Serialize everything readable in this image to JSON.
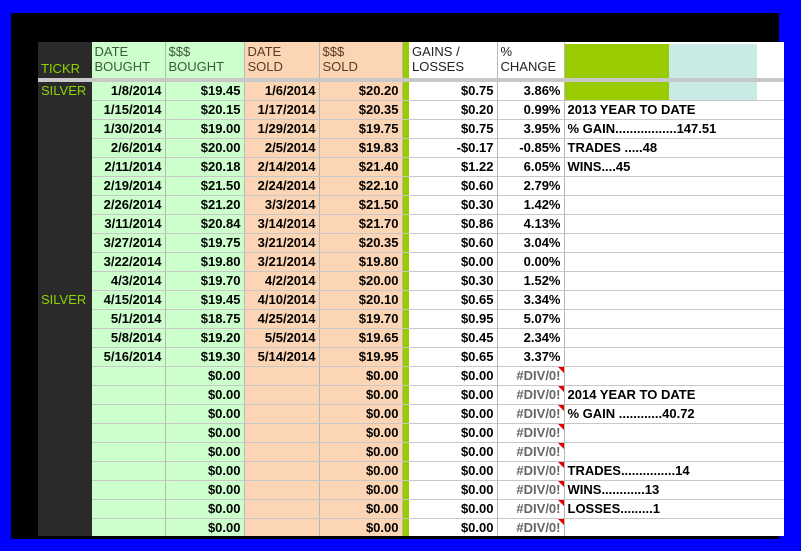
{
  "headers": {
    "tickr": "TICKR",
    "date_bought": [
      "DATE",
      "BOUGHT"
    ],
    "price_bought": [
      "$$$",
      "BOUGHT"
    ],
    "date_sold": [
      "DATE",
      "SOLD"
    ],
    "price_sold": [
      "$$$",
      "SOLD"
    ],
    "gains": [
      "GAINS /",
      "LOSSES"
    ],
    "pct_change": [
      "%",
      "CHANGE"
    ]
  },
  "rows": [
    {
      "tickr": "SILVER",
      "date_bought": "1/8/2014",
      "bought": "$19.45",
      "date_sold": "1/6/2014",
      "sold": "$20.20",
      "gain": "$0.75",
      "pct": "3.86%",
      "note": ""
    },
    {
      "tickr": "",
      "date_bought": "1/15/2014",
      "bought": "$20.15",
      "date_sold": "1/17/2014",
      "sold": "$20.35",
      "gain": "$0.20",
      "pct": "0.99%",
      "note": "2013 YEAR TO DATE"
    },
    {
      "tickr": "",
      "date_bought": "1/30/2014",
      "bought": "$19.00",
      "date_sold": "1/29/2014",
      "sold": "$19.75",
      "gain": "$0.75",
      "pct": "3.95%",
      "note": "% GAIN.................147.51"
    },
    {
      "tickr": "",
      "date_bought": "2/6/2014",
      "bought": "$20.00",
      "date_sold": "2/5/2014",
      "sold": "$19.83",
      "gain": "-$0.17",
      "pct": "-0.85%",
      "note": "TRADES .....48"
    },
    {
      "tickr": "",
      "date_bought": "2/11/2014",
      "bought": "$20.18",
      "date_sold": "2/14/2014",
      "sold": "$21.40",
      "gain": "$1.22",
      "pct": "6.05%",
      "note": "WINS....45"
    },
    {
      "tickr": "",
      "date_bought": "2/19/2014",
      "bought": "$21.50",
      "date_sold": "2/24/2014",
      "sold": "$22.10",
      "gain": "$0.60",
      "pct": "2.79%",
      "note": ""
    },
    {
      "tickr": "",
      "date_bought": "2/26/2014",
      "bought": "$21.20",
      "date_sold": "3/3/2014",
      "sold": "$21.50",
      "gain": "$0.30",
      "pct": "1.42%",
      "note": ""
    },
    {
      "tickr": "",
      "date_bought": "3/11/2014",
      "bought": "$20.84",
      "date_sold": "3/14/2014",
      "sold": "$21.70",
      "gain": "$0.86",
      "pct": "4.13%",
      "note": ""
    },
    {
      "tickr": "",
      "date_bought": "3/27/2014",
      "bought": "$19.75",
      "date_sold": "3/21/2014",
      "sold": "$20.35",
      "gain": "$0.60",
      "pct": "3.04%",
      "note": ""
    },
    {
      "tickr": "",
      "date_bought": "3/22/2014",
      "bought": "$19.80",
      "date_sold": "3/21/2014",
      "sold": "$19.80",
      "gain": "$0.00",
      "pct": "0.00%",
      "note": ""
    },
    {
      "tickr": "",
      "date_bought": "4/3/2014",
      "bought": "$19.70",
      "date_sold": "4/2/2014",
      "sold": "$20.00",
      "gain": "$0.30",
      "pct": "1.52%",
      "note": ""
    },
    {
      "tickr": "SILVER",
      "date_bought": "4/15/2014",
      "bought": "$19.45",
      "date_sold": "4/10/2014",
      "sold": "$20.10",
      "gain": "$0.65",
      "pct": "3.34%",
      "note": ""
    },
    {
      "tickr": "",
      "date_bought": "5/1/2014",
      "bought": "$18.75",
      "date_sold": "4/25/2014",
      "sold": "$19.70",
      "gain": "$0.95",
      "pct": "5.07%",
      "note": ""
    },
    {
      "tickr": "",
      "date_bought": "5/8/2014",
      "bought": "$19.20",
      "date_sold": "5/5/2014",
      "sold": "$19.65",
      "gain": "$0.45",
      "pct": "2.34%",
      "note": ""
    },
    {
      "tickr": "",
      "date_bought": "5/16/2014",
      "bought": "$19.30",
      "date_sold": "5/14/2014",
      "sold": "$19.95",
      "gain": "$0.65",
      "pct": "3.37%",
      "note": ""
    },
    {
      "tickr": "",
      "date_bought": "",
      "bought": "$0.00",
      "date_sold": "",
      "sold": "$0.00",
      "gain": "$0.00",
      "pct": "#DIV/0!",
      "note": ""
    },
    {
      "tickr": "",
      "date_bought": "",
      "bought": "$0.00",
      "date_sold": "",
      "sold": "$0.00",
      "gain": "$0.00",
      "pct": "#DIV/0!",
      "note": "2014 YEAR TO DATE"
    },
    {
      "tickr": "",
      "date_bought": "",
      "bought": "$0.00",
      "date_sold": "",
      "sold": "$0.00",
      "gain": "$0.00",
      "pct": "#DIV/0!",
      "note": "% GAIN ............40.72"
    },
    {
      "tickr": "",
      "date_bought": "",
      "bought": "$0.00",
      "date_sold": "",
      "sold": "$0.00",
      "gain": "$0.00",
      "pct": "#DIV/0!",
      "note": ""
    },
    {
      "tickr": "",
      "date_bought": "",
      "bought": "$0.00",
      "date_sold": "",
      "sold": "$0.00",
      "gain": "$0.00",
      "pct": "#DIV/0!",
      "note": ""
    },
    {
      "tickr": "",
      "date_bought": "",
      "bought": "$0.00",
      "date_sold": "",
      "sold": "$0.00",
      "gain": "$0.00",
      "pct": "#DIV/0!",
      "note": "TRADES...............14"
    },
    {
      "tickr": "",
      "date_bought": "",
      "bought": "$0.00",
      "date_sold": "",
      "sold": "$0.00",
      "gain": "$0.00",
      "pct": "#DIV/0!",
      "note": "WINS............13"
    },
    {
      "tickr": "",
      "date_bought": "",
      "bought": "$0.00",
      "date_sold": "",
      "sold": "$0.00",
      "gain": "$0.00",
      "pct": "#DIV/0!",
      "note": "LOSSES.........1"
    },
    {
      "tickr": "",
      "date_bought": "",
      "bought": "$0.00",
      "date_sold": "",
      "sold": "$0.00",
      "gain": "$0.00",
      "pct": "#DIV/0!",
      "note": ""
    }
  ],
  "colors": {
    "frame_border": "#0000ff",
    "tickr_column": "#2a2a2a",
    "tickr_text": "#8cd400",
    "bought_fill": "#ccffcc",
    "sold_fill": "#fcd5b4",
    "divider_green": "#99cc00",
    "aqua_fill": "#c9ebe6",
    "error_marker": "#e00000"
  }
}
